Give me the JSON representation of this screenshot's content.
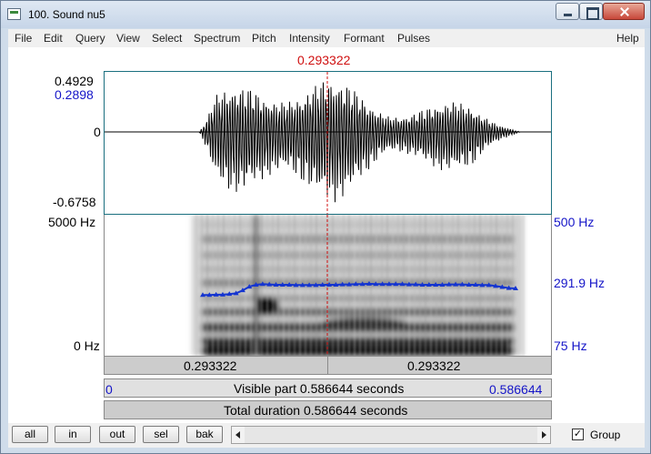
{
  "window": {
    "title": "100. Sound nu5"
  },
  "menu": [
    "File",
    "Edit",
    "Query",
    "View",
    "Select",
    "Spectrum",
    "Pitch",
    "Intensity",
    "Formant",
    "Pulses",
    "Help"
  ],
  "cursor": {
    "time": "0.293322",
    "color": "#d01010"
  },
  "waveform": {
    "max_label": "0.4929",
    "cursor_value_label": "0.2898",
    "zero_label": "0",
    "min_label": "-0.6758",
    "max_value": 0.4929,
    "min_value": -0.6758
  },
  "spectrogram": {
    "freq_top_label": "5000 Hz",
    "freq_bottom_label": "0 Hz"
  },
  "pitch": {
    "top_label": "500 Hz",
    "current_label": "291.9 Hz",
    "bottom_label": "75 Hz",
    "color": "#1535d0",
    "contour_hz": [
      258,
      258,
      259,
      259,
      261,
      263,
      272,
      283,
      289,
      291,
      290,
      289,
      289,
      289,
      288,
      288,
      288,
      288,
      289,
      289,
      289,
      290,
      290,
      291,
      291,
      292,
      291,
      291,
      291,
      291,
      291,
      290,
      290,
      289,
      289,
      289,
      289,
      290,
      290,
      290,
      289,
      289,
      288,
      288,
      285,
      282,
      279,
      278
    ]
  },
  "time_bar": {
    "left_segment": "0.293322",
    "right_segment": "0.293322",
    "visible_start": "0",
    "visible_text": "Visible part 0.586644 seconds",
    "visible_end": "0.586644",
    "total_text": "Total duration 0.586644 seconds"
  },
  "buttons": {
    "all": "all",
    "in": "in",
    "out": "out",
    "sel": "sel",
    "bak": "bak"
  },
  "group": {
    "label": "Group",
    "checked": true
  }
}
